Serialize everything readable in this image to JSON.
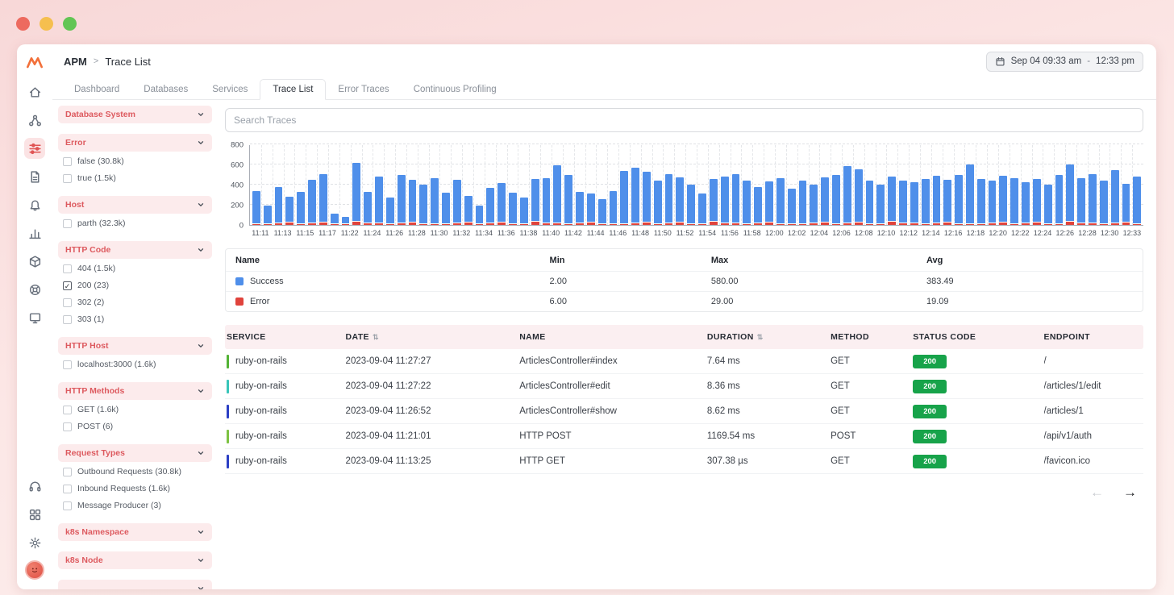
{
  "window": {
    "traffic_lights": [
      "#ed6a5f",
      "#f5bf4f",
      "#62c554"
    ]
  },
  "sidebar": {
    "icons": [
      {
        "name": "middleware-logo"
      },
      {
        "name": "home-icon"
      },
      {
        "name": "organization-icon"
      },
      {
        "name": "trace-list-icon",
        "active": true
      },
      {
        "name": "document-icon"
      },
      {
        "name": "notifications-icon"
      },
      {
        "name": "bar-chart-icon"
      },
      {
        "name": "package-icon"
      },
      {
        "name": "help-icon"
      },
      {
        "name": "monitor-icon"
      }
    ],
    "bottom_icons": [
      {
        "name": "support-headset-icon"
      },
      {
        "name": "apps-grid-icon"
      },
      {
        "name": "settings-gear-icon"
      },
      {
        "name": "user-avatar"
      }
    ]
  },
  "header": {
    "breadcrumb": [
      "APM",
      "Trace List"
    ],
    "separator": ">",
    "date_range": {
      "start": "Sep 04 09:33 am",
      "separator": "-",
      "end": "12:33 pm"
    }
  },
  "tabs": {
    "items": [
      "Dashboard",
      "Databases",
      "Services",
      "Trace List",
      "Error Traces",
      "Continuous Profiling"
    ],
    "active": "Trace List"
  },
  "filters": {
    "sections": [
      {
        "title": "Database System",
        "options": []
      },
      {
        "title": "Error",
        "options": [
          {
            "label": "false (30.8k)",
            "checked": false
          },
          {
            "label": "true (1.5k)",
            "checked": false
          }
        ]
      },
      {
        "title": "Host",
        "options": [
          {
            "label": "parth (32.3k)",
            "checked": false
          }
        ]
      },
      {
        "title": "HTTP Code",
        "options": [
          {
            "label": "404 (1.5k)",
            "checked": false
          },
          {
            "label": "200 (23)",
            "checked": true
          },
          {
            "label": "302 (2)",
            "checked": false
          },
          {
            "label": "303 (1)",
            "checked": false
          }
        ]
      },
      {
        "title": "HTTP Host",
        "options": [
          {
            "label": "localhost:3000 (1.6k)",
            "checked": false
          }
        ]
      },
      {
        "title": "HTTP Methods",
        "options": [
          {
            "label": "GET (1.6k)",
            "checked": false
          },
          {
            "label": "POST (6)",
            "checked": false
          }
        ]
      },
      {
        "title": "Request Types",
        "options": [
          {
            "label": "Outbound Requests (30.8k)",
            "checked": false
          },
          {
            "label": "Inbound Requests (1.6k)",
            "checked": false
          },
          {
            "label": "Message Producer (3)",
            "checked": false
          }
        ]
      },
      {
        "title": "k8s Namespace",
        "options": []
      },
      {
        "title": "k8s Node",
        "options": []
      },
      {
        "title": "",
        "options": []
      }
    ]
  },
  "search": {
    "placeholder": "Search Traces"
  },
  "chart_data": {
    "type": "bar",
    "title": "",
    "xlabel": "",
    "ylabel": "",
    "x_labels": [
      "11:11",
      "11:13",
      "11:15",
      "11:17",
      "11:22",
      "11:24",
      "11:26",
      "11:28",
      "11:30",
      "11:32",
      "11:34",
      "11:36",
      "11:38",
      "11:40",
      "11:42",
      "11:44",
      "11:46",
      "11:48",
      "11:50",
      "11:52",
      "11:54",
      "11:56",
      "11:58",
      "12:00",
      "12:02",
      "12:04",
      "12:06",
      "12:08",
      "12:10",
      "12:12",
      "12:14",
      "12:16",
      "12:18",
      "12:20",
      "12:22",
      "12:24",
      "12:26",
      "12:28",
      "12:30",
      "12:33"
    ],
    "yticks": [
      0,
      200,
      400,
      600,
      800
    ],
    "ylim": [
      0,
      800
    ],
    "grid": "dashed",
    "legend_position": "table-below",
    "series": [
      {
        "name": "Success",
        "color": "#4f8fea",
        "values": [
          320,
          175,
          355,
          250,
          305,
          420,
          475,
          90,
          60,
          580,
          305,
          450,
          255,
          475,
          420,
          380,
          445,
          300,
          425,
          260,
          175,
          340,
          385,
          300,
          255,
          420,
          445,
          565,
          480,
          300,
          280,
          235,
          320,
          515,
          545,
          495,
          420,
          475,
          440,
          380,
          295,
          420,
          460,
          480,
          420,
          355,
          400,
          445,
          340,
          420,
          380,
          440,
          480,
          560,
          520,
          420,
          380,
          445,
          420,
          400,
          440,
          460,
          420,
          480,
          580,
          440,
          420,
          460,
          445,
          400,
          420,
          380,
          480,
          560,
          440,
          480,
          420,
          520,
          380,
          460
        ]
      },
      {
        "name": "Error",
        "color": "#e0433c",
        "values": [
          12,
          8,
          15,
          22,
          9,
          18,
          25,
          7,
          11,
          29,
          14,
          20,
          10,
          17,
          23,
          6,
          12,
          8,
          15,
          22,
          9,
          18,
          25,
          7,
          11,
          29,
          14,
          20,
          10,
          17,
          23,
          6,
          12,
          8,
          15,
          22,
          9,
          18,
          25,
          7,
          11,
          29,
          14,
          20,
          10,
          17,
          23,
          6,
          12,
          8,
          15,
          22,
          9,
          18,
          25,
          7,
          11,
          29,
          14,
          20,
          10,
          17,
          23,
          6,
          12,
          8,
          15,
          22,
          9,
          18,
          25,
          7,
          11,
          29,
          14,
          20,
          10,
          17,
          23,
          6
        ]
      }
    ]
  },
  "legend": {
    "headers": [
      "Name",
      "Min",
      "Max",
      "Avg"
    ],
    "rows": [
      {
        "name": "Success",
        "color": "#4f8fea",
        "min": "2.00",
        "max": "580.00",
        "avg": "383.49"
      },
      {
        "name": "Error",
        "color": "#e0433c",
        "min": "6.00",
        "max": "29.00",
        "avg": "19.09"
      }
    ]
  },
  "table": {
    "columns": [
      {
        "key": "service",
        "label": "SERVICE",
        "sortable": false
      },
      {
        "key": "date",
        "label": "DATE",
        "sortable": true
      },
      {
        "key": "name",
        "label": "NAME",
        "sortable": false
      },
      {
        "key": "duration",
        "label": "DURATION",
        "sortable": true
      },
      {
        "key": "method",
        "label": "METHOD",
        "sortable": false
      },
      {
        "key": "status_code",
        "label": "STATUS CODE",
        "sortable": false
      },
      {
        "key": "endpoint",
        "label": "ENDPOINT",
        "sortable": false
      }
    ],
    "rows": [
      {
        "accent": "#52b335",
        "service": "ruby-on-rails",
        "date": "2023-09-04 11:27:27",
        "name": "ArticlesController#index",
        "duration": "7.64 ms",
        "method": "GET",
        "status_code": "200",
        "endpoint": "/"
      },
      {
        "accent": "#38c5b9",
        "service": "ruby-on-rails",
        "date": "2023-09-04 11:27:22",
        "name": "ArticlesController#edit",
        "duration": "8.36 ms",
        "method": "GET",
        "status_code": "200",
        "endpoint": "/articles/1/edit"
      },
      {
        "accent": "#2b3fc4",
        "service": "ruby-on-rails",
        "date": "2023-09-04 11:26:52",
        "name": "ArticlesController#show",
        "duration": "8.62 ms",
        "method": "GET",
        "status_code": "200",
        "endpoint": "/articles/1"
      },
      {
        "accent": "#7dc242",
        "service": "ruby-on-rails",
        "date": "2023-09-04 11:21:01",
        "name": "HTTP POST",
        "duration": "1169.54 ms",
        "method": "POST",
        "status_code": "200",
        "endpoint": "/api/v1/auth"
      },
      {
        "accent": "#2b3fc4",
        "service": "ruby-on-rails",
        "date": "2023-09-04 11:13:25",
        "name": "HTTP GET",
        "duration": "307.38 µs",
        "method": "GET",
        "status_code": "200",
        "endpoint": "/favicon.ico"
      }
    ]
  },
  "pagination": {
    "prev": "←",
    "next": "→"
  },
  "colors": {
    "accent_red": "#e25757",
    "filter_header_bg": "#fcebec",
    "table_header_bg": "#fbeff1",
    "badge_green": "#17a34a",
    "bar_blue": "#4f8fea",
    "bar_red": "#e0433c"
  }
}
